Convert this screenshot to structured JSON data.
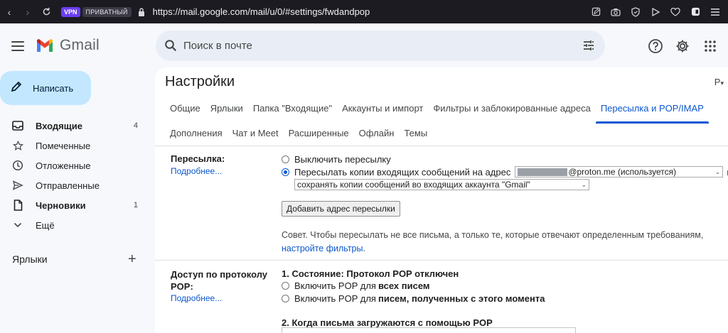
{
  "browser": {
    "vpn_badge": "VPN",
    "private_badge": "ПРИВАТНЫЙ",
    "url": "https://mail.google.com/mail/u/0/#settings/fwdandpop"
  },
  "header": {
    "app_name": "Gmail",
    "search_placeholder": "Поиск в почте"
  },
  "compose": {
    "label": "Написать"
  },
  "sidebar": {
    "items": [
      {
        "label": "Входящие",
        "count": "4",
        "bold": true,
        "icon": "inbox-icon"
      },
      {
        "label": "Помеченные",
        "count": "",
        "bold": false,
        "icon": "star-icon"
      },
      {
        "label": "Отложенные",
        "count": "",
        "bold": false,
        "icon": "clock-icon"
      },
      {
        "label": "Отправленные",
        "count": "",
        "bold": false,
        "icon": "send-icon"
      },
      {
        "label": "Черновики",
        "count": "1",
        "bold": true,
        "icon": "draft-icon"
      },
      {
        "label": "Ещё",
        "count": "",
        "bold": false,
        "icon": "chevron-down-icon"
      }
    ],
    "labels_heading": "Ярлыки",
    "labels_add": "+"
  },
  "settings": {
    "title": "Настройки",
    "lang": "Р",
    "tabs_row1": [
      {
        "label": "Общие",
        "active": false
      },
      {
        "label": "Ярлыки",
        "active": false
      },
      {
        "label": "Папка \"Входящие\"",
        "active": false
      },
      {
        "label": "Аккаунты и импорт",
        "active": false
      },
      {
        "label": "Фильтры и заблокированные адреса",
        "active": false
      },
      {
        "label": "Пересылка и POP/IMAP",
        "active": true
      }
    ],
    "tabs_row2": [
      {
        "label": "Дополнения"
      },
      {
        "label": "Чат и Meet"
      },
      {
        "label": "Расширенные"
      },
      {
        "label": "Офлайн"
      },
      {
        "label": "Темы"
      }
    ],
    "forwarding": {
      "label": "Пересылка:",
      "more_link": "Подробнее...",
      "option_off": "Выключить пересылку",
      "option_on": "Пересылать копии входящих сообщений на адрес",
      "address_select": "@proton.me (используется)",
      "and": "и",
      "keep_select": "сохранять копии сообщений во входящих аккаунта \"Gmail\"",
      "add_button": "Добавить адрес пересылки",
      "tip_text": "Совет. Чтобы пересылать не все письма, а только те, которые отвечают определенным требованиям,",
      "tip_link": "настройте фильтры",
      "tip_end": "."
    },
    "pop": {
      "label_line1": "Доступ по протоколу",
      "label_line2": "POP:",
      "more_link": "Подробнее...",
      "status_title": "1. Состояние: Протокол POP отключен",
      "opt_all_prefix": "Включить POP для ",
      "opt_all_bold": "всех писем",
      "opt_new_prefix": "Включить POP для ",
      "opt_new_bold": "писем, полученных с этого момента",
      "when_title": "2. Когда письма загружаются с помощью POP"
    }
  }
}
